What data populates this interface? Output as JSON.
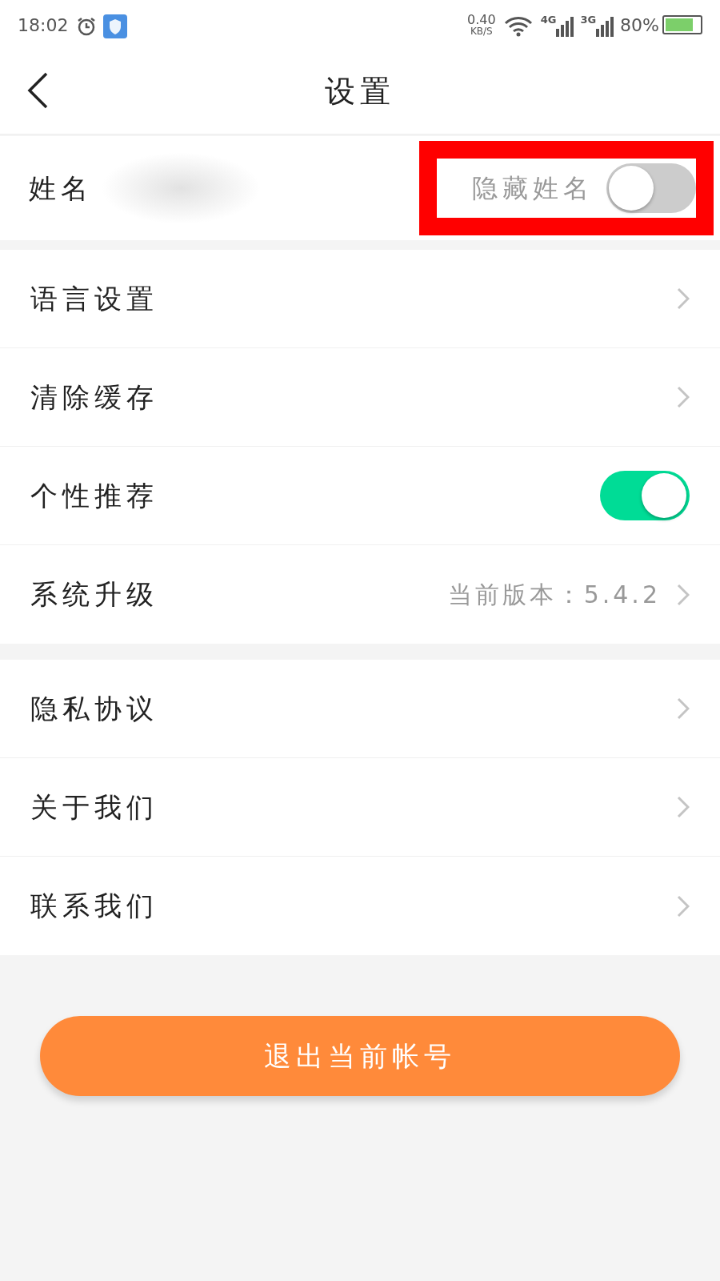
{
  "status_bar": {
    "time": "18:02",
    "speed_value": "0.40",
    "speed_unit": "KB/S",
    "network_1": "4G",
    "network_2": "3G",
    "battery": "80%"
  },
  "header": {
    "title": "设置"
  },
  "name_row": {
    "label": "姓名",
    "hide_label": "隐藏姓名",
    "hide_on": false,
    "highlighted": true
  },
  "groups": [
    [
      {
        "kind": "chevron",
        "label": "语言设置"
      },
      {
        "kind": "chevron",
        "label": "清除缓存"
      },
      {
        "kind": "toggle",
        "label": "个性推荐",
        "on": true
      },
      {
        "kind": "value",
        "label": "系统升级",
        "value": "当前版本：5.4.2"
      }
    ],
    [
      {
        "kind": "chevron",
        "label": "隐私协议"
      },
      {
        "kind": "chevron",
        "label": "关于我们"
      },
      {
        "kind": "chevron",
        "label": "联系我们"
      }
    ]
  ],
  "logout_button": "退出当前帐号"
}
